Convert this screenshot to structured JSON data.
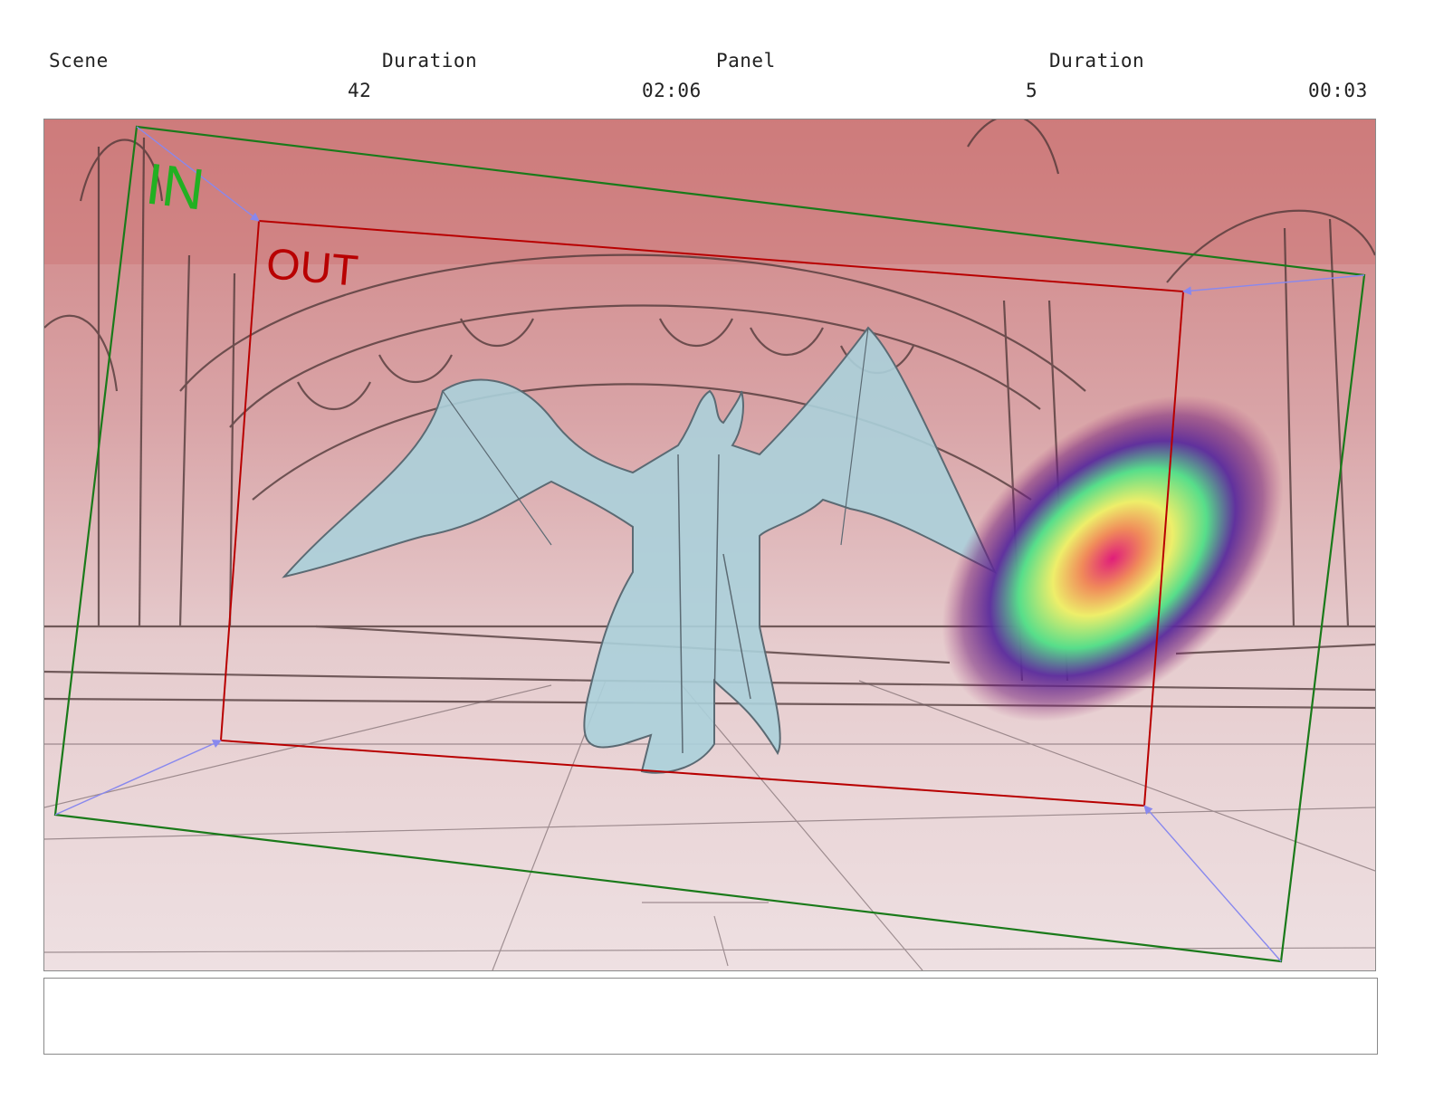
{
  "header": {
    "scene_label": "Scene",
    "scene_duration_label": "Duration",
    "panel_label": "Panel",
    "panel_duration_label": "Duration",
    "scene_value": "42",
    "scene_duration_value": "02:06",
    "panel_value": "5",
    "panel_duration_value": "00:03"
  },
  "frame": {
    "in_label": "IN",
    "out_label": "OUT",
    "in_color": "#1a7a1a",
    "in_text_color": "#22b022",
    "out_color": "#b80000",
    "arrow_color": "#8888ee"
  },
  "notes": {
    "text": ""
  }
}
